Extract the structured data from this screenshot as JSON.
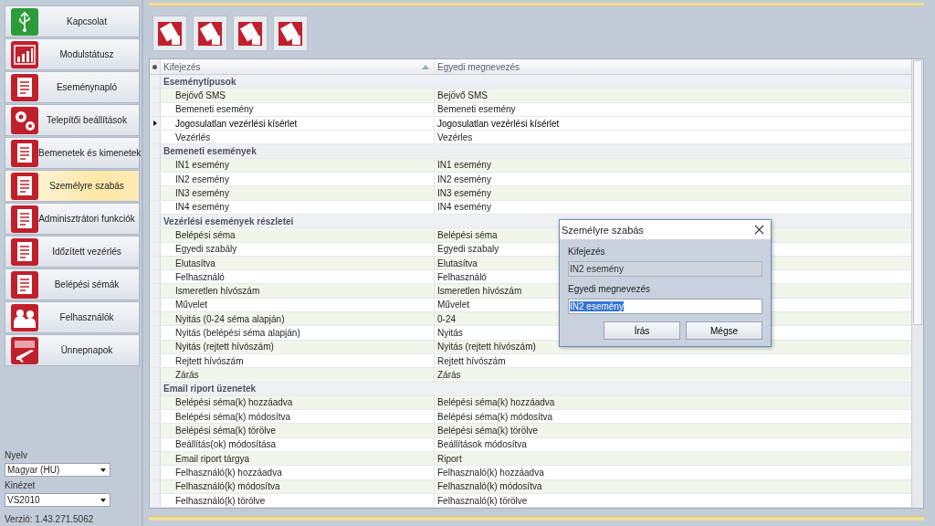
{
  "nav": [
    {
      "label": "Kapcsolat",
      "kind": "usb",
      "color": "#2f9a3a",
      "selected": false
    },
    {
      "label": "Modulstátusz",
      "kind": "chart",
      "color": "#c0202c",
      "selected": false
    },
    {
      "label": "Eseménynapló",
      "kind": "log",
      "color": "#c0202c",
      "selected": false
    },
    {
      "label": "Telepítői beállítások",
      "kind": "gears",
      "color": "#c0202c",
      "selected": false
    },
    {
      "label": "Bemenetek és kimenetek",
      "kind": "io",
      "color": "#c0202c",
      "selected": false
    },
    {
      "label": "Személyre szabás",
      "kind": "custom",
      "color": "#c0202c",
      "selected": true
    },
    {
      "label": "Adminisztrátori funkciók",
      "kind": "admin",
      "color": "#c0202c",
      "selected": false
    },
    {
      "label": "Időzített vezérlés",
      "kind": "schedule",
      "color": "#c0202c",
      "selected": false
    },
    {
      "label": "Belépési sémák",
      "kind": "schema",
      "color": "#c0202c",
      "selected": false
    },
    {
      "label": "Felhasználók",
      "kind": "users",
      "color": "#c0202c",
      "selected": false
    },
    {
      "label": "Ünnepnapok",
      "kind": "holiday",
      "color": "#c0202c",
      "selected": false
    }
  ],
  "settings": [
    {
      "label": "Nyelv",
      "value": "Magyar (HU)"
    },
    {
      "label": "Kinézet",
      "value": "VS2010"
    }
  ],
  "version": "Verzió: 1.43.271.5062",
  "table": {
    "columns": [
      {
        "label": "Kifejezés",
        "sorted": true
      },
      {
        "label": "Egyedi megnevezés",
        "sorted": false
      }
    ],
    "groups": [
      {
        "label": "Eseménytípusok",
        "rows": [
          {
            "expression": "Bejövő SMS",
            "name": "Bejövő SMS",
            "selected": false
          },
          {
            "expression": "Bemeneti esemény",
            "name": "Bemeneti esemény",
            "selected": false
          },
          {
            "expression": "Jogosulatlan vezérlési kísérlet",
            "name": "Jogosulatlan vezérlési kísérlet",
            "selected": true
          },
          {
            "expression": "Vezérlés",
            "name": "Vezérles",
            "selected": false
          }
        ]
      },
      {
        "label": "Bemeneti események",
        "rows": [
          {
            "expression": "IN1 esemény",
            "name": "IN1 esemény",
            "selected": false
          },
          {
            "expression": "IN2 esemény",
            "name": "IN2 esemény",
            "selected": false
          },
          {
            "expression": "IN3 esemény",
            "name": "IN3 esemény",
            "selected": false
          },
          {
            "expression": "IN4 esemény",
            "name": "IN4 esemény",
            "selected": false
          }
        ]
      },
      {
        "label": "Vezérlési események részletei",
        "rows": [
          {
            "expression": "Belépési séma",
            "name": "Belépési séma",
            "selected": false
          },
          {
            "expression": "Egyedi szabály",
            "name": "Egyedi szabaly",
            "selected": false
          },
          {
            "expression": "Elutasítva",
            "name": "Elutasítva",
            "selected": false
          },
          {
            "expression": "Felhasználó",
            "name": "Felhasználó",
            "selected": false
          },
          {
            "expression": "Ismeretlen hívószám",
            "name": "Ismeretlen hívószám",
            "selected": false
          },
          {
            "expression": "Művelet",
            "name": "Művelet",
            "selected": false
          },
          {
            "expression": "Nyitás (0-24 séma alapján)",
            "name": "0-24",
            "selected": false
          },
          {
            "expression": "Nyitás (belépési séma alapján)",
            "name": "Nyitás",
            "selected": false
          },
          {
            "expression": "Nyitás (rejtett hívószám)",
            "name": "Nyitás (rejtett hívószám)",
            "selected": false
          },
          {
            "expression": "Rejtett hívószám",
            "name": "Rejtett hívószám",
            "selected": false
          },
          {
            "expression": "Zárás",
            "name": "Zárás",
            "selected": false
          }
        ]
      },
      {
        "label": "Email riport üzenetek",
        "rows": [
          {
            "expression": "Belépési séma(k) hozzáadva",
            "name": "Belépési séma(k) hozzáadva",
            "selected": false
          },
          {
            "expression": "Belépési séma(k) módosítva",
            "name": "Belépési séma(k) módosítva",
            "selected": false
          },
          {
            "expression": "Belépési séma(k) törölve",
            "name": "Belépési séma(k) törölve",
            "selected": false
          },
          {
            "expression": "Beállítás(ok) módosítása",
            "name": "Beállítások módosítva",
            "selected": false
          },
          {
            "expression": "Email riport tárgya",
            "name": "Riport",
            "selected": false
          },
          {
            "expression": "Felhasználó(k) hozzáadva",
            "name": "Felhasznaló(k) hozzáadva",
            "selected": false
          },
          {
            "expression": "Felhasználó(k) módosítva",
            "name": "Felhasznaló(k) módosítva",
            "selected": false
          },
          {
            "expression": "Felhasználó(k) törölve",
            "name": "Felhasznaló(k) törölve",
            "selected": false
          }
        ]
      }
    ]
  },
  "dialog": {
    "title": "Személyre szabás",
    "fields": [
      {
        "label": "Kifejezés",
        "value": "IN2 esemény",
        "disabled": true
      },
      {
        "label": "Egyedi megnevezés",
        "value": "IN2 esemény",
        "disabled": false
      }
    ],
    "buttons": [
      "Írás",
      "Mégse"
    ]
  }
}
